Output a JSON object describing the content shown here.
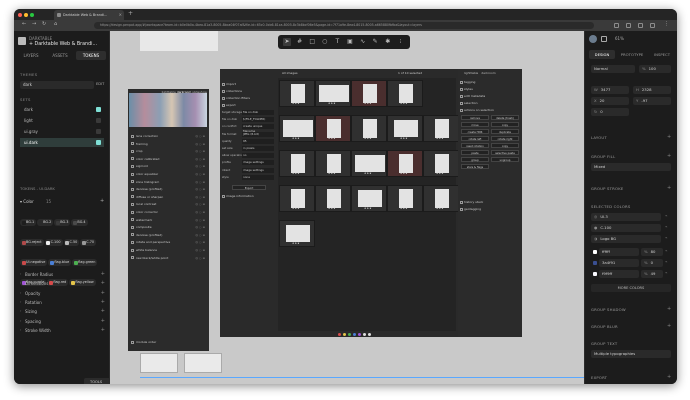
{
  "browser": {
    "tab_title": "Darktable Web & Brandi...",
    "url": "https://design.penpot.app/#/workspace?team-id=b0e0b0a-4bea-81a3-8005-8bca04f07af&file-id=65c0-0cb6-81ca-8005-8c3b8bcf06e5&page-id=7f71a9e-8ea4-8015-8005-a665880fbfba&layout=layers"
  },
  "left": {
    "file_title": "DARKTABLE",
    "file_name": "+ Darktable Web & Brandi...",
    "tabs": [
      "LAYERS",
      "ASSETS",
      "TOKENS"
    ],
    "themes_header": "THEMES",
    "theme_value": "dark",
    "theme_edit": "EDIT",
    "sets_header": "SETS",
    "sets": [
      {
        "label": "dark",
        "on": true
      },
      {
        "label": "light",
        "on": false
      },
      {
        "label": "ui.gray",
        "on": false
      },
      {
        "label": "ui.dark",
        "on": true
      }
    ],
    "tokens_header": "TOKENS - UI.DARK",
    "color_header": "Color",
    "color_count": "15",
    "chips": [
      {
        "label": "BG.1",
        "color": "#1e1e1e"
      },
      {
        "label": "BG.2",
        "color": "#2a2a2a"
      },
      {
        "label": "BG.3",
        "color": "#3a3a3a"
      },
      {
        "label": "BG.4",
        "color": "#4a4a4a"
      },
      {
        "label": "BG.reject",
        "color": "#b04a4a"
      },
      {
        "label": "C.100",
        "color": "#eeeeee"
      },
      {
        "label": "C.50",
        "color": "#bbbbbb"
      },
      {
        "label": "C.70",
        "color": "#999999"
      },
      {
        "label": "UI.negative",
        "color": "#c94a4a"
      },
      {
        "label": "flag.blue",
        "color": "#4a7fd6"
      },
      {
        "label": "flag.green",
        "color": "#4caf50"
      },
      {
        "label": "flag.purple",
        "color": "#a155d6"
      },
      {
        "label": "flag.red",
        "color": "#d64a4a"
      },
      {
        "label": "flag.yellow",
        "color": "#e3c44a"
      }
    ],
    "properties": [
      "Border Radius",
      "Dimensions",
      "Opacity",
      "Rotation",
      "Sizing",
      "Spacing",
      "Stroke Width"
    ],
    "tools_button": "TOOLS"
  },
  "canvas": {
    "toolbar": [
      "select",
      "frame",
      "rect",
      "ellipse",
      "text",
      "image",
      "curve",
      "path",
      "comments",
      "plugins"
    ],
    "dt": {
      "left_tabs": [
        "lighttable",
        "darkroom",
        "slideshow"
      ],
      "left_modules": [
        "lens correction",
        "framing",
        "crop",
        "color calibrated",
        "sigmoid",
        "color equalizer",
        "zone histogram",
        "denoise (profiled)",
        "diffuse or sharpen",
        "local contrast",
        "color corrector",
        "watermark",
        "composite",
        "denoise (profiled)",
        "rotate and perspective",
        "white balance",
        "raw black/white point"
      ],
      "left_footer": "module order",
      "lib_modules": [
        "import",
        "collections",
        "collection filters",
        "export"
      ],
      "export_fields": [
        {
          "k": "target storage",
          "v": "file on disk"
        },
        {
          "k": "file on disk",
          "v": "$(FILE_FOLDER)"
        },
        {
          "k": "on conflict",
          "v": "create unique filename"
        },
        {
          "k": "file format",
          "v": "JPEG (8-bit)"
        },
        {
          "k": "quality",
          "v": "95"
        },
        {
          "k": "set size",
          "v": "in pixels"
        },
        {
          "k": "allow upscaling",
          "v": "no"
        },
        {
          "k": "profile",
          "v": "image settings"
        },
        {
          "k": "intent",
          "v": "image settings"
        },
        {
          "k": "style",
          "v": "none"
        }
      ],
      "export_button": "Export",
      "image_info": "image information",
      "grid_top": "All images",
      "grid_count": "1 of 10 selected",
      "right_tabs": [
        "lighttable",
        "darkroom"
      ],
      "right_modules": [
        "tagging",
        "styles",
        "edit metadata",
        "selection",
        "actions on selection",
        "history stack",
        "geotagging"
      ],
      "right_buttons": [
        "remove",
        "delete (trash)",
        "move",
        "copy",
        "create HDR",
        "duplicate",
        "rotate left",
        "rotate right",
        "reset rotation",
        "copy",
        "paste",
        "selective paste",
        "group",
        "ungroup",
        "stars & flags"
      ],
      "stars": "★★★"
    }
  },
  "right": {
    "zoom": "61%",
    "tabs": [
      "DESIGN",
      "PROTOTYPE",
      "INSPECT"
    ],
    "layer_mode": "Normal",
    "opacity_label": "%",
    "opacity": "100",
    "w_label": "W",
    "w": "3477",
    "h_label": "H",
    "h": "2328",
    "x_label": "X",
    "x": "20",
    "y_label": "Y",
    "y": "-97",
    "rotation": "0",
    "layout": "LAYOUT",
    "group_fill": "GROUP FILL",
    "fill_value": "Mixed",
    "group_stroke": "GROUP STROKE",
    "selected_colors": "SELECTED COLORS",
    "token_chips": [
      "UI.3",
      "C.100",
      "Logo BG"
    ],
    "colors": [
      {
        "hex": "ffffff",
        "opacity": "80",
        "swatch": "#ffffff"
      },
      {
        "hex": "3a4f91",
        "opacity": "0",
        "swatch": "#3a4f91"
      },
      {
        "hex": "f9f9ff",
        "opacity": "49",
        "swatch": "#f9f9ff"
      }
    ],
    "more_colors": "MORE COLORS",
    "group_shadow": "GROUP SHADOW",
    "group_blur": "GROUP BLUR",
    "group_text": "GROUP TEXT",
    "typographies": "Multiple typographies",
    "export": "EXPORT"
  },
  "colors": {
    "accent": "#7fe0d6",
    "selection": "#5aa8ff"
  }
}
